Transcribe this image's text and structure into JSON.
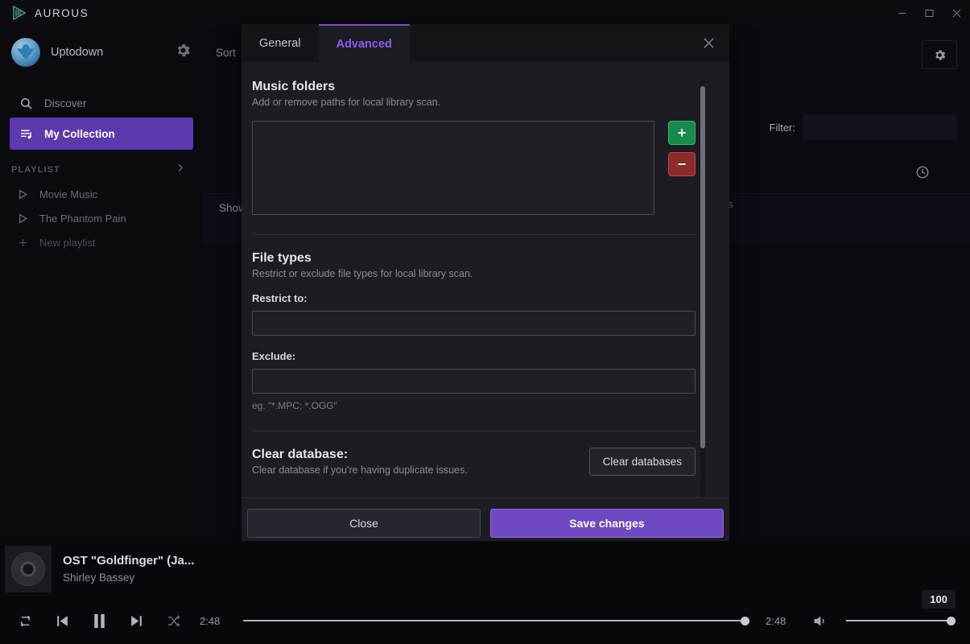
{
  "window": {
    "app_name": "AUROUS",
    "logo_icon": "play-triangle-icon",
    "minimize_label": "–",
    "maximize_label": "□",
    "close_label": "×",
    "accent_purple": "#5b39ad",
    "accent_teal": "#2fae8a"
  },
  "sidebar": {
    "user": {
      "name": "Uptodown",
      "settings_icon": "gear-icon",
      "avatar_icon": "user-avatar"
    },
    "nav": [
      {
        "label": "Discover",
        "icon": "search-icon",
        "active": false
      },
      {
        "label": "My Collection",
        "icon": "collection-icon",
        "active": true
      }
    ],
    "playlist_header": {
      "label": "PLAYLIST",
      "chevron_icon": "chevron-right-icon"
    },
    "playlists": [
      {
        "label": "Movie Music",
        "icon": "play-icon"
      },
      {
        "label": "The Phantom Pain",
        "icon": "play-icon"
      },
      {
        "label": "New playlist",
        "icon": "plus-icon"
      }
    ]
  },
  "content": {
    "sort_label": "Sort",
    "show_label": "Show",
    "settings_icon": "gear-icon",
    "filter_label": "Filter:",
    "filter_value": "",
    "clock_icon": "clock-icon",
    "ghost_text": "gs"
  },
  "dialog": {
    "tabs": [
      {
        "label": "General",
        "active": false
      },
      {
        "label": "Advanced",
        "active": true
      }
    ],
    "close_icon": "close-icon",
    "music_folders": {
      "title": "Music folders",
      "subtitle": "Add or remove paths for local library scan.",
      "items": [],
      "add_label": "+",
      "remove_label": "−"
    },
    "file_types": {
      "title": "File types",
      "subtitle": "Restrict or exclude file types for local library scan.",
      "restrict_label": "Restrict to:",
      "restrict_value": "",
      "exclude_label": "Exclude:",
      "exclude_value": "",
      "hint": "eg. \"*.MPC; *.OGG\""
    },
    "clear_database": {
      "title": "Clear database:",
      "subtitle": "Clear database if you're having duplicate issues.",
      "button_label": "Clear databases"
    },
    "footer": {
      "close_label": "Close",
      "save_label": "Save changes"
    }
  },
  "player": {
    "track_title": "OST \"Goldfinger\" (Ja...",
    "track_artist": "Shirley Bassey",
    "elapsed_time": "2:48",
    "total_time": "2:48",
    "volume_value": "100",
    "repeat_icon": "repeat-icon",
    "previous_icon": "previous-icon",
    "pause_icon": "pause-icon",
    "next_icon": "next-icon",
    "shuffle_icon": "shuffle-icon",
    "volume_icon": "volume-icon"
  }
}
